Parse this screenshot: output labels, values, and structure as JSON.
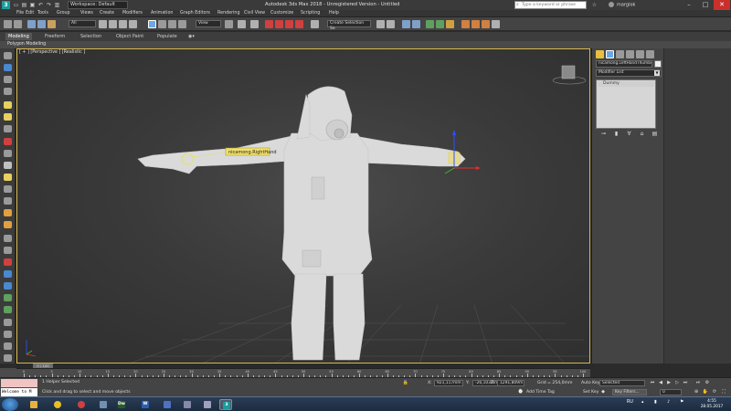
{
  "window": {
    "app_logo": "3",
    "workspace_label": "Workspace: Default",
    "title": "Autodesk 3ds Max 2018 - Unregistered Version - Untitled",
    "search_placeholder": "Type a keyword or phrase",
    "username": "marglok",
    "minimize": "–",
    "maximize": "□",
    "close": "✕"
  },
  "menu": [
    "File",
    "Edit",
    "Tools",
    "Group",
    "Views",
    "Create",
    "Modifiers",
    "Animation",
    "Graph Editors",
    "Rendering",
    "Civil View",
    "Customize",
    "Scripting",
    "Help"
  ],
  "toolbar": {
    "selection_filter": "All",
    "reference_coord": "View",
    "named_selection": "Create Selection Se"
  },
  "ribbon": {
    "tabs": [
      "Modeling",
      "Freeform",
      "Selection",
      "Object Paint",
      "Populate"
    ],
    "active_tab": "Modeling",
    "subtab": "Polygon Modeling"
  },
  "viewport": {
    "label": "[ + ] [Perspective ] [Realistic ]",
    "object_tag": "nicamong.RightHand"
  },
  "command_panel": {
    "object_name": "nicamong.LeftHandThumb4",
    "modifier_list": "Modifier List",
    "stack_item": "Dummy"
  },
  "timeline": {
    "slider": "0 / 100",
    "ticks": [
      0,
      5,
      10,
      15,
      20,
      25,
      30,
      35,
      40,
      45,
      50,
      55,
      60,
      65,
      70,
      75,
      80,
      85,
      90,
      95,
      100
    ]
  },
  "status": {
    "maxscript_output": "Welcome to M",
    "selection": "1 Helper Selected",
    "prompt": "Click and drag to select and move objects",
    "x_label": "X:",
    "x_value": "921,117mm",
    "y_label": "Y:",
    "y_value": "-26,103mm",
    "z_label": "Z:",
    "z_value": "1291,809m",
    "grid": "Grid = 254,0mm",
    "add_time_tag": "Add Time Tag",
    "auto_key": "Auto Key",
    "set_key": "Set Key",
    "key_filter": "Selected",
    "key_filters_btn": "Key Filters...",
    "frame": "0"
  },
  "taskbar": {
    "lang": "RU",
    "time": "4:55",
    "date": "28.05.2017"
  },
  "colors": {
    "viewport_border": "#d8b74a",
    "accent": "#1a9d9d",
    "gizmo_x": "#e03030",
    "gizmo_y": "#30c030",
    "gizmo_z": "#3050ff",
    "tag_bg": "#f0e070"
  }
}
